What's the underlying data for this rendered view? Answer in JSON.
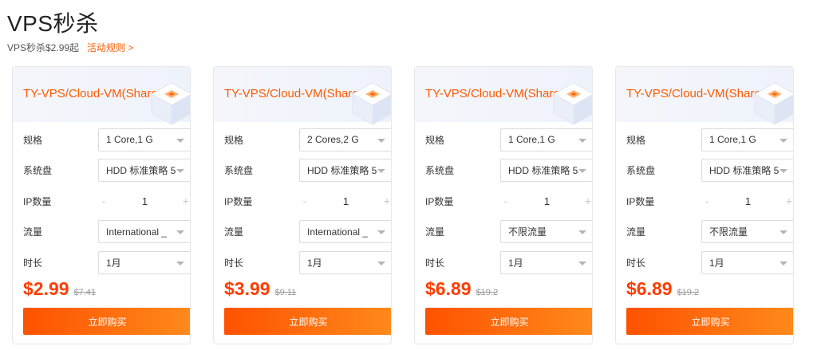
{
  "page": {
    "title": "VPS秒杀",
    "subtitle": "VPS秒杀$2.99起",
    "rules_link": "活动规则 >"
  },
  "labels": {
    "spec": "规格",
    "disk": "系统盘",
    "ip": "IP数量",
    "traffic": "流量",
    "duration": "时长"
  },
  "cards": [
    {
      "title": "TY-VPS/Cloud-VM(Shared)",
      "spec": "1 Core,1 G",
      "disk": "HDD 标准策略 5",
      "ip_minus": "-",
      "ip_count": "1",
      "ip_plus": "+",
      "traffic": "International _",
      "duration": "1月",
      "price": "$2.99",
      "old_price": "$7.41",
      "buy": "立即购买"
    },
    {
      "title": "TY-VPS/Cloud-VM(Shared)",
      "spec": "2 Cores,2 G",
      "disk": "HDD 标准策略 5",
      "ip_minus": "-",
      "ip_count": "1",
      "ip_plus": "+",
      "traffic": "International _",
      "duration": "1月",
      "price": "$3.99",
      "old_price": "$9.11",
      "buy": "立即购买"
    },
    {
      "title": "TY-VPS/Cloud-VM(Shared)",
      "spec": "1 Core,1 G",
      "disk": "HDD 标准策略 5",
      "ip_minus": "-",
      "ip_count": "1",
      "ip_plus": "+",
      "traffic": "不限流量",
      "duration": "1月",
      "price": "$6.89",
      "old_price": "$19.2",
      "buy": "立即购买"
    },
    {
      "title": "TY-VPS/Cloud-VM(Shared)",
      "spec": "1 Core,1 G",
      "disk": "HDD 标准策略 5",
      "ip_minus": "-",
      "ip_count": "1",
      "ip_plus": "+",
      "traffic": "不限流量",
      "duration": "1月",
      "price": "$6.89",
      "old_price": "$19.2",
      "buy": "立即购买"
    }
  ],
  "colors": {
    "accent": "#ff5a00",
    "price": "#ff3d00",
    "button_start": "#ff5200",
    "button_end": "#ff8a1c",
    "header_bg": "#f4f6fb"
  },
  "icons": {
    "cube": "server-cube-icon",
    "caret": "chevron-down-icon"
  }
}
